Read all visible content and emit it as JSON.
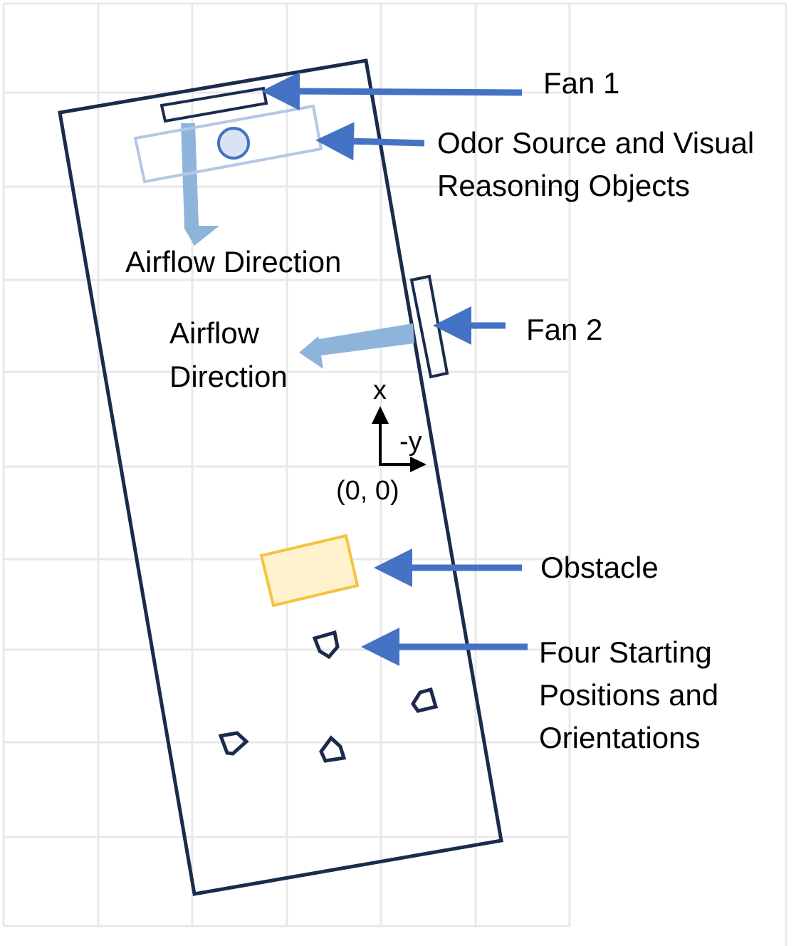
{
  "labels": {
    "fan1": "Fan 1",
    "odor_line1": "Odor Source and Visual",
    "odor_line2": "Reasoning Objects",
    "airflow_top": "Airflow Direction",
    "fan2": "Fan 2",
    "airflow_mid_line1": "Airflow",
    "airflow_mid_line2": "Direction",
    "axis_x": "x",
    "axis_y": "-y",
    "origin": "(0, 0)",
    "obstacle": "Obstacle",
    "start_line1": "Four Starting",
    "start_line2": "Positions and",
    "start_line3": "Orientations"
  },
  "colors": {
    "grid": "#e8e8e8",
    "arena_outline": "#1a2b4c",
    "pointer_arrow": "#4472c4",
    "airflow_arrow": "#8fb4dc",
    "object_zone": "#b4c7e7",
    "odor_source_fill": "#dae3f3",
    "obstacle_fill": "#fff2cc",
    "obstacle_stroke": "#f5c242"
  }
}
